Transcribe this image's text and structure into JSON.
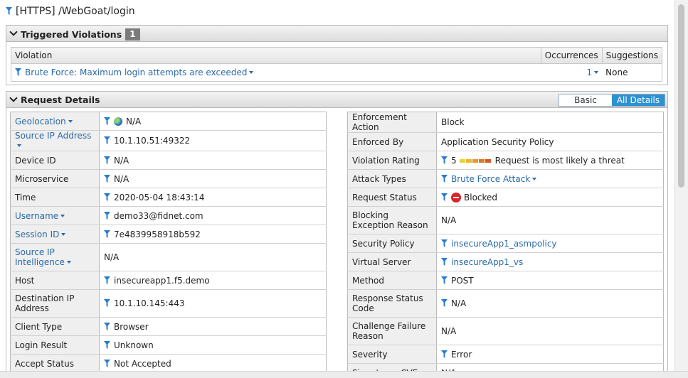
{
  "colors": {
    "link": "#2a6aa8",
    "filter": "#2a7bd0",
    "toggle_active": "#2b91d3",
    "blocked": "#d92525"
  },
  "title": "[HTTPS] /WebGoat/login",
  "violations": {
    "header": "Triggered Violations",
    "count": "1",
    "columns": [
      "Violation",
      "Occurrences",
      "Suggestions"
    ],
    "rows": [
      {
        "violation": "Brute Force: Maximum login attempts are exceeded",
        "occurrences": "1",
        "suggestions": "None"
      }
    ]
  },
  "request": {
    "header": "Request Details",
    "toggle": {
      "basic": "Basic",
      "all": "All Details"
    },
    "left": [
      {
        "key": "Geolocation",
        "value": "N/A"
      },
      {
        "key": "Source IP Address",
        "value": "10.1.10.51:49322"
      },
      {
        "key": "Device ID",
        "value": "N/A"
      },
      {
        "key": "Microservice",
        "value": "N/A"
      },
      {
        "key": "Time",
        "value": "2020-05-04 18:43:14"
      },
      {
        "key": "Username",
        "value": "demo33@fidnet.com"
      },
      {
        "key": "Session ID",
        "value": "7e4839958918b592"
      },
      {
        "key": "Source IP Intelligence",
        "value": "N/A"
      },
      {
        "key": "Host",
        "value": "insecureapp1.f5.demo"
      },
      {
        "key": "Destination IP Address",
        "value": "10.1.10.145:443"
      },
      {
        "key": "Client Type",
        "value": "Browser"
      },
      {
        "key": "Login Result",
        "value": "Unknown"
      },
      {
        "key": "Accept Status",
        "value": "Not Accepted"
      }
    ],
    "right": [
      {
        "key": "Enforcement Action",
        "value": "Block"
      },
      {
        "key": "Enforced By",
        "value": "Application Security Policy"
      },
      {
        "key": "Violation Rating",
        "value": "5",
        "extra": "Request is most likely a threat"
      },
      {
        "key": "Attack Types",
        "value": "Brute Force Attack"
      },
      {
        "key": "Request Status",
        "value": "Blocked"
      },
      {
        "key": "Blocking Exception Reason",
        "value": "N/A"
      },
      {
        "key": "Security Policy",
        "value": "insecureApp1_asmpolicy"
      },
      {
        "key": "Virtual Server",
        "value": "insecureApp1_vs"
      },
      {
        "key": "Method",
        "value": "POST"
      },
      {
        "key": "Response Status Code",
        "value": "N/A"
      },
      {
        "key": "Challenge Failure Reason",
        "value": "N/A"
      },
      {
        "key": "Severity",
        "value": "Error"
      },
      {
        "key": "Signatures CVEs",
        "value": "N/A"
      }
    ]
  }
}
